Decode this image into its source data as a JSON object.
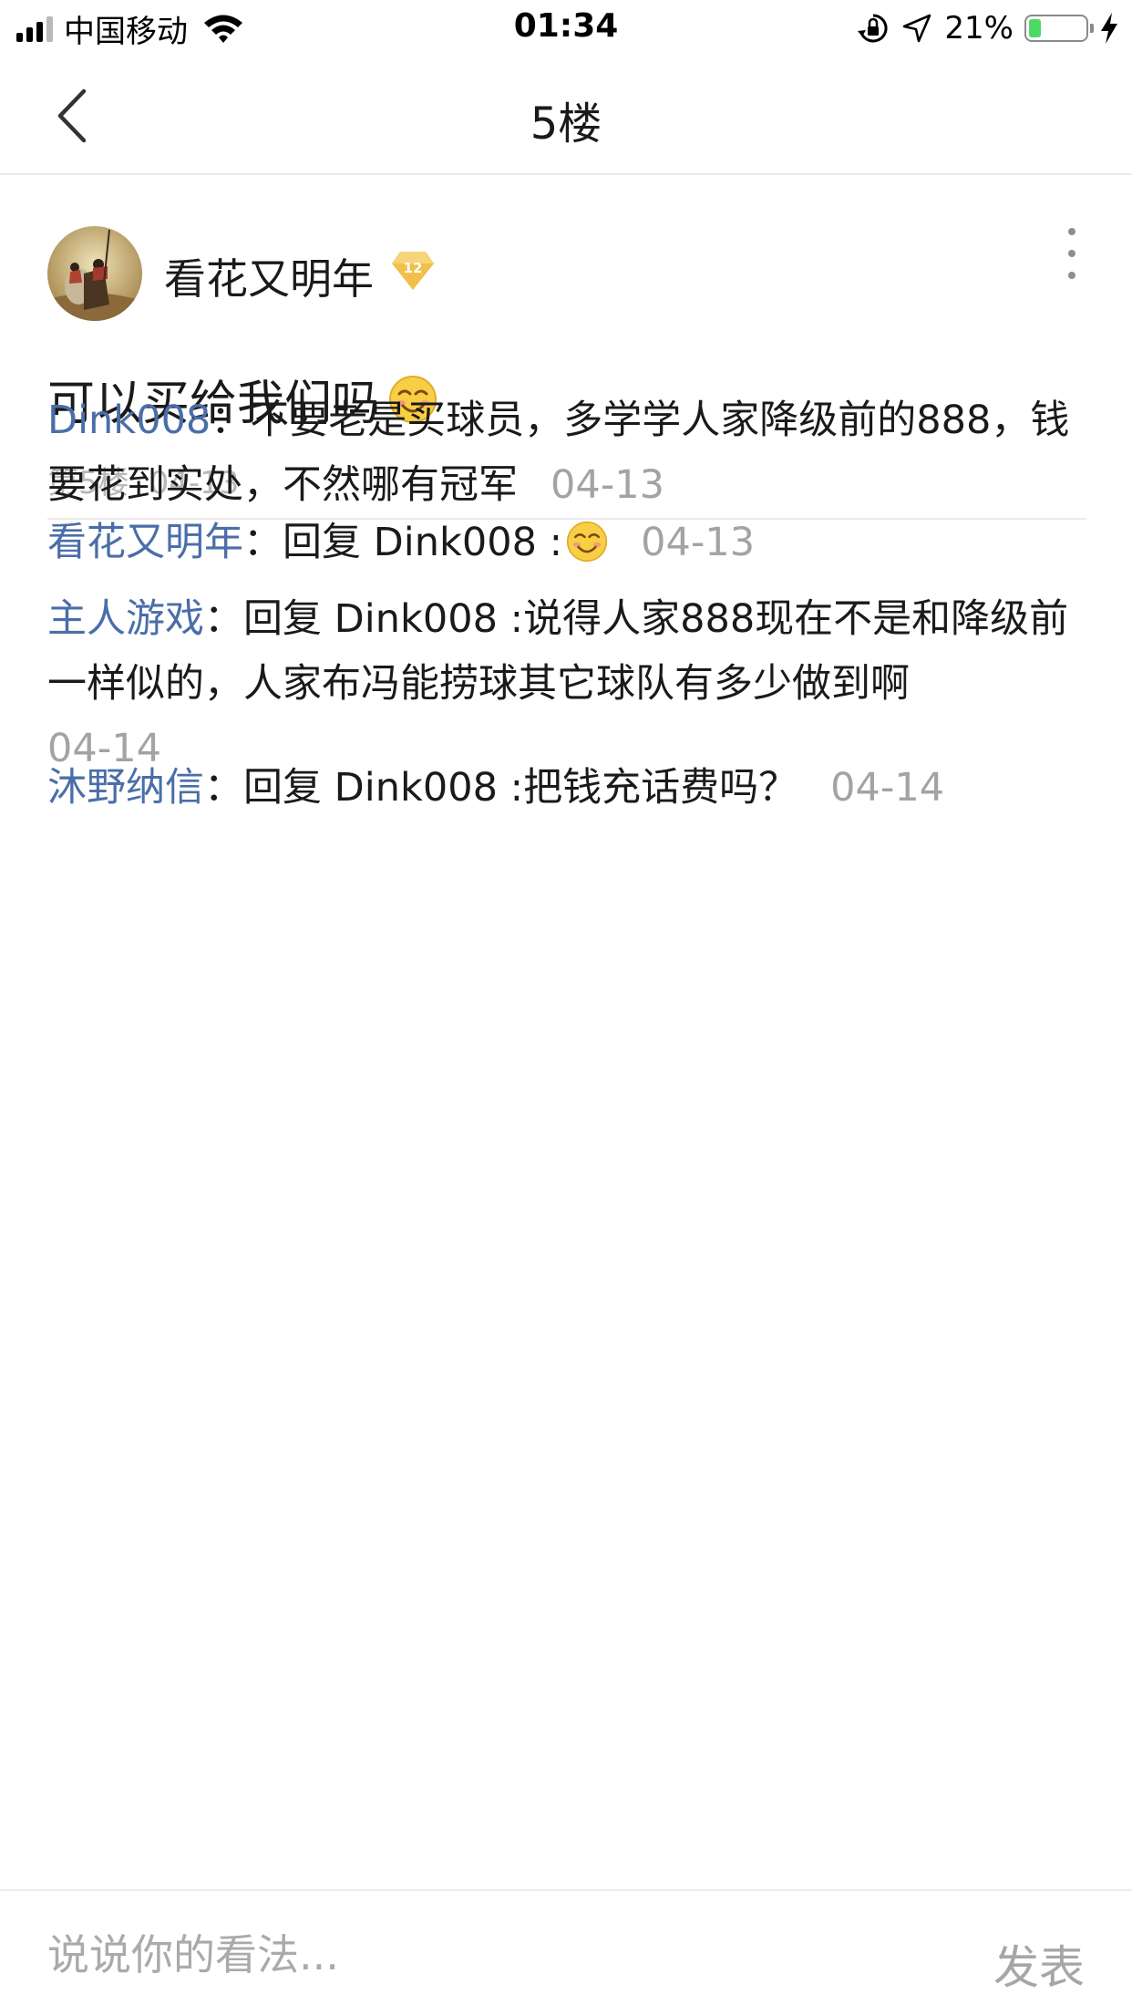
{
  "status_bar": {
    "carrier": "中国移动",
    "time": "01:34",
    "battery_percent": "21%",
    "battery_level": 0.21,
    "battery_fill_color": "#4cd964",
    "icons": [
      "signal-icon",
      "wifi-icon",
      "orientation-lock-icon",
      "location-arrow-icon",
      "battery-icon",
      "charging-bolt-icon"
    ]
  },
  "nav": {
    "title": "5楼",
    "back_icon": "chevron-left-icon"
  },
  "post": {
    "username": "看花又明年",
    "level": "12",
    "content": "可以买给我们吗",
    "floor_label": "第5楼",
    "date": "04-13",
    "more_icon": "more-vertical-icon",
    "emoji_icon": "smile-emoji-icon"
  },
  "replies": [
    {
      "username": "Dink008",
      "separator": "：",
      "text": "不要老是买球员，多学学人家降级前的888，钱要花到实处，不然哪有冠军",
      "date": "04-13"
    },
    {
      "username": "看花又明年",
      "separator": "：",
      "text": "回复 Dink008 :",
      "has_emoji": true,
      "date": "04-13"
    },
    {
      "username": "主人游戏",
      "separator": "：",
      "text": "回复 Dink008 :说得人家888现在不是和降级前一样似的，人家布冯能捞球其它球队有多少做到啊",
      "date": "04-14"
    },
    {
      "username": "沐野纳信",
      "separator": "：",
      "text": "回复 Dink008 :把钱充话费吗？",
      "date": "04-14"
    }
  ],
  "composer": {
    "placeholder": "说说你的看法...",
    "value": "",
    "send_label": "发表"
  },
  "colors": {
    "username_link": "#4a6ea8",
    "date_gray": "#a3a3a3",
    "badge_gold": "#f2c04a"
  }
}
